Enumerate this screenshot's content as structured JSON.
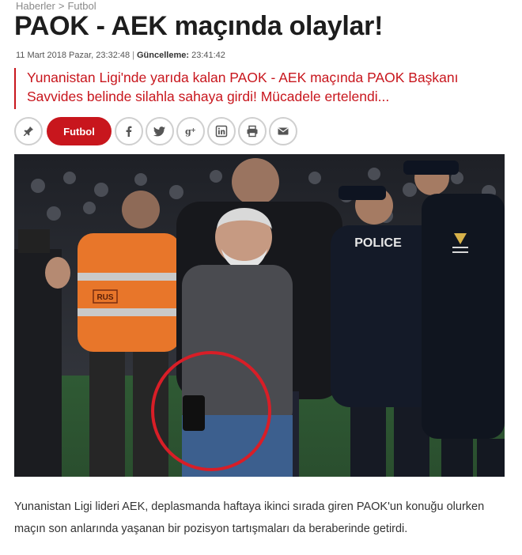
{
  "breadcrumb": {
    "home": "Haberler",
    "separator": ">",
    "section": "Futbol"
  },
  "article": {
    "title": "PAOK - AEK maçında olaylar!",
    "date": "11 Mart 2018 Pazar, 23:32:48",
    "separator": "|",
    "updated_label": "Güncelleme:",
    "updated_time": "23:41:42",
    "spot": "Yunanistan Ligi'nde yarıda kalan PAOK - AEK maçında PAOK Başkanı Savvides belinde silahla sahaya girdi! Mücadele ertelendi...",
    "paragraph": "Yunanistan Ligi lideri AEK, deplasmanda haftaya ikinci sırada giren PAOK'un konuğu olurken maçın son anlarında yaşanan bir pozisyon tartışmaları da beraberinde getirdi."
  },
  "share_bar": {
    "category_tag": "Futbol",
    "icons": [
      "pin-icon",
      "facebook-icon",
      "twitter-icon",
      "google-plus-icon",
      "linkedin-icon",
      "print-icon",
      "email-icon"
    ]
  },
  "photo": {
    "vest_text": "RUS",
    "police_text": "POLICE",
    "highlight_color": "#d81e27"
  },
  "colors": {
    "accent": "#c8161d",
    "title": "#1d1d1d",
    "muted": "#8a8a8a"
  }
}
